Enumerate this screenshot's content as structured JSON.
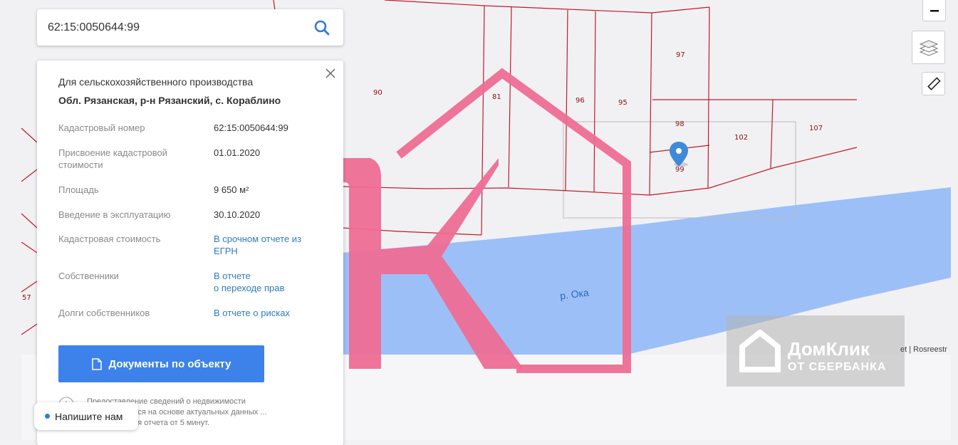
{
  "search": {
    "value": "62:15:0050644:99"
  },
  "panel": {
    "land_use": "Для сельскохозяйственного производства",
    "address": "Обл. Рязанская, р-н Рязанский, с. Кораблино",
    "rows": [
      {
        "label": "Кадастровый номер",
        "value": "62:15:0050644:99"
      },
      {
        "label": "Присвоение кадастровой стоимости",
        "value": "01.01.2020"
      },
      {
        "label": "Площадь",
        "value": "9 650 м²"
      },
      {
        "label": "Введение в эксплуатацию",
        "value": "30.10.2020"
      },
      {
        "label": "Кадастровая стоимость",
        "value": "В срочном отчете из ЕГРН"
      },
      {
        "label": "Собственники",
        "value_line1": "В отчете",
        "value_line2": "о переходе прав"
      },
      {
        "label": "Долги собственников",
        "value": "В отчете о рисках"
      }
    ],
    "docs_button": "Документы по объекту",
    "notice": "Предоставление сведений о недвижимости осуществляется на основе актуальных данных ... формирования отчета от 5 минут."
  },
  "chat": {
    "label": "Напишите нам"
  },
  "map": {
    "river_label": "р. Ока",
    "attribution": "et | Rosreestr",
    "parcel_labels": [
      "90",
      "81",
      "96",
      "95",
      "97",
      "98",
      "102",
      "107",
      "99",
      "57"
    ]
  },
  "watermark": {
    "brand_line1": "ДомКлик",
    "brand_line2": "ОТ СБЕРБАНКА"
  },
  "colors": {
    "accent": "#3d82ea",
    "parcel_line": "#c21a2a",
    "river": "#9dbff7",
    "watermark_pink": "#ee6d95"
  }
}
